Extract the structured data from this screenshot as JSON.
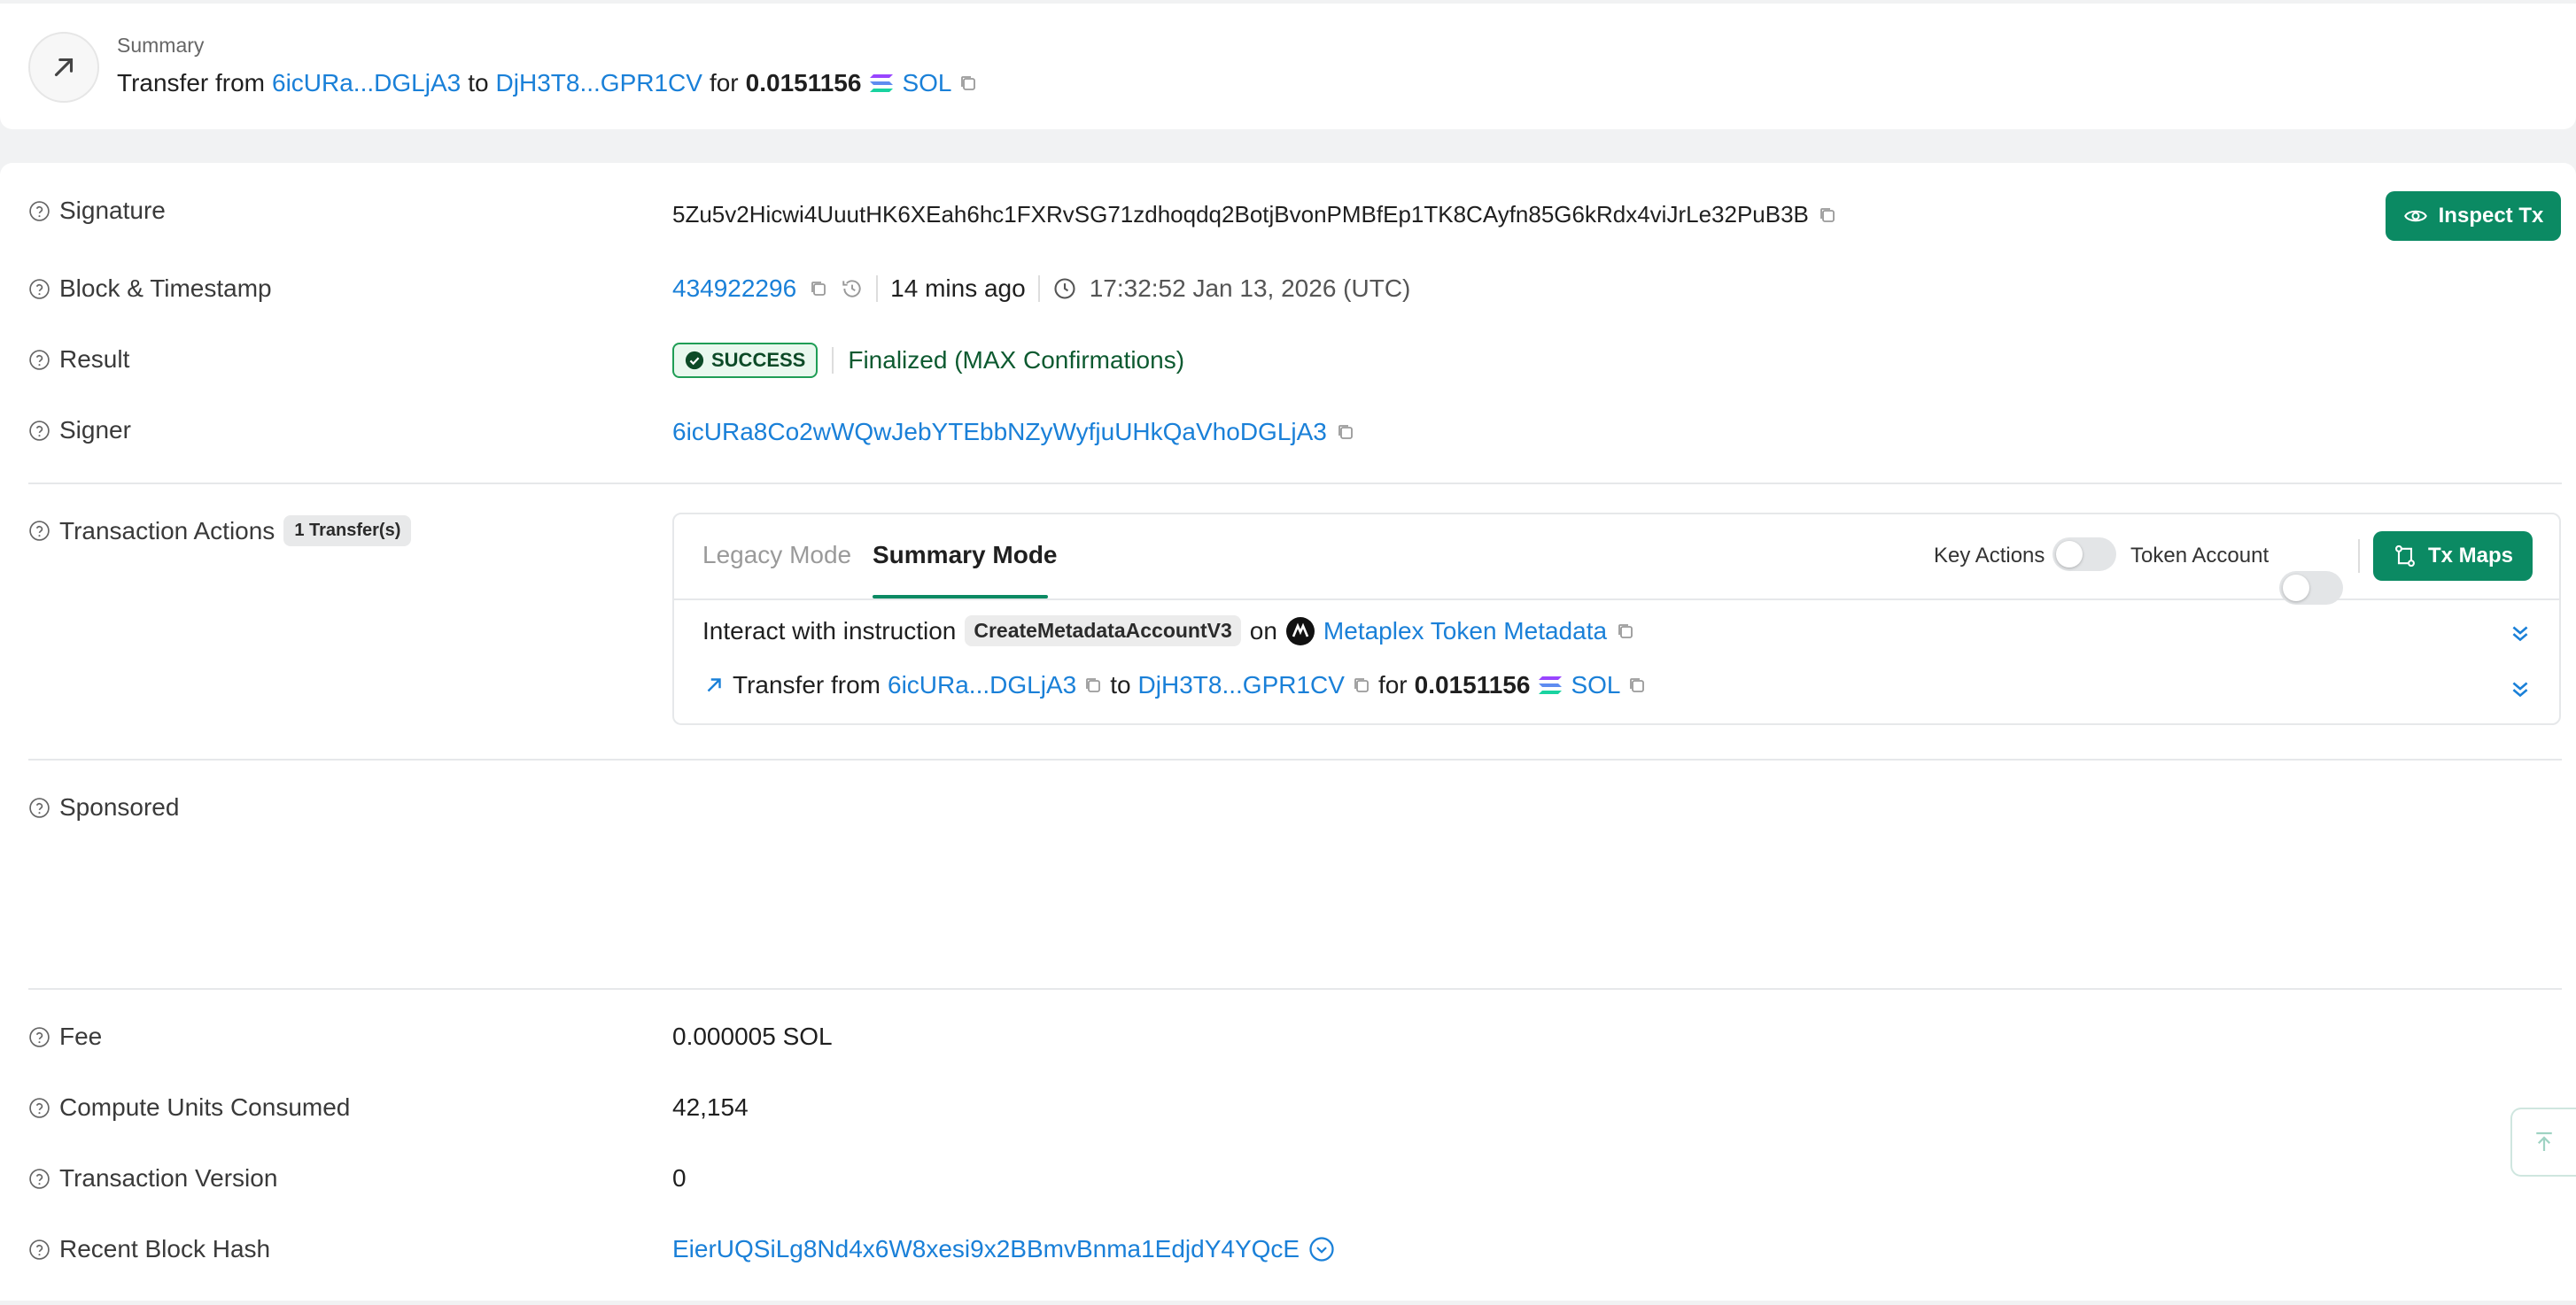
{
  "summary": {
    "heading": "Summary",
    "transfer_word": "Transfer from",
    "from_short": "6icURa...DGLjA3",
    "to_word": "to",
    "to_short": "DjH3T8...GPR1CV",
    "for_word": "for",
    "amount": "0.0151156",
    "token": "SOL"
  },
  "rows": {
    "signature": {
      "label": "Signature",
      "value": "5Zu5v2Hicwi4UuutHK6XEah6hc1FXRvSG71zdhoqdq2BotjBvonPMBfEp1TK8CAyfn85G6kRdx4viJrLe32PuB3B"
    },
    "block": {
      "label": "Block & Timestamp",
      "slot": "434922296",
      "ago": "14 mins ago",
      "timestamp": "17:32:52 Jan 13, 2026 (UTC)"
    },
    "result": {
      "label": "Result",
      "status": "SUCCESS",
      "finality": "Finalized (MAX Confirmations)"
    },
    "signer": {
      "label": "Signer",
      "value": "6icURa8Co2wWQwJebYTEbbNZyWyfjuUHkQaVhoDGLjA3"
    },
    "actions": {
      "label": "Transaction Actions",
      "badge": "1 Transfer(s)"
    },
    "sponsored": {
      "label": "Sponsored"
    },
    "fee": {
      "label": "Fee",
      "value": "0.000005 SOL"
    },
    "compute": {
      "label": "Compute Units Consumed",
      "value": "42,154"
    },
    "version": {
      "label": "Transaction Version",
      "value": "0"
    },
    "blockhash": {
      "label": "Recent Block Hash",
      "value": "EierUQSiLg8Nd4x6W8xesi9x2BBmvBnma1EdjdY4YQcE"
    }
  },
  "inspect_button": "Inspect Tx",
  "actions_panel": {
    "tabs": [
      "Legacy Mode",
      "Summary Mode"
    ],
    "active_tab": "Summary Mode",
    "key_actions_label": "Key Actions",
    "token_account_label": "Token Account",
    "tx_maps_label": "Tx Maps",
    "instruction": {
      "prefix": "Interact with instruction",
      "name": "CreateMetadataAccountV3",
      "on_word": "on",
      "program": "Metaplex Token Metadata"
    },
    "transfer": {
      "word": "Transfer from",
      "from": "6icURa...DGLjA3",
      "to_word": "to",
      "to": "DjH3T8...GPR1CV",
      "for_word": "for",
      "amount": "0.0151156",
      "token": "SOL"
    }
  },
  "colors": {
    "link": "#1a80d8",
    "accent_green": "#0b8a63",
    "success_border": "#1f9d55"
  },
  "icons": [
    "arrow-up-right-icon",
    "copy-icon",
    "help-circle-icon",
    "eye-icon",
    "history-icon",
    "clock-icon",
    "check-circle-icon",
    "tx-maps-icon",
    "chevron-double-down-icon",
    "chevron-down-circle-icon",
    "scroll-top-icon",
    "sol-logo-icon",
    "metaplex-logo-icon"
  ]
}
